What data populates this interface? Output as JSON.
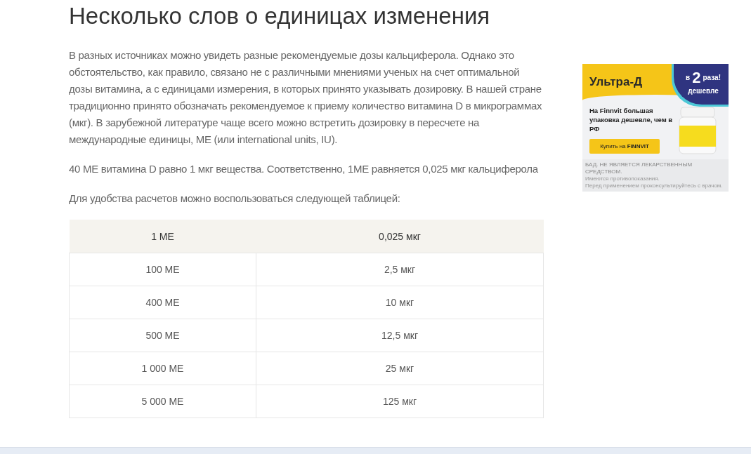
{
  "heading": "Несколько слов о единицах изменения",
  "paragraphs": [
    "В разных источниках можно увидеть разные рекомендуемые дозы кальциферола. Однако это обстоятельство, как правило, связано не с различными мнениями ученых на счет оптимальной дозы витамина, а с единицами измерения, в которых принято указывать дозировку. В нашей стране традиционно принято обозначать рекомендуемое к приему количество витамина D в микрограммах (мкг). В зарубежной литературе чаще всего можно встретить дозировку в пересчете на международные единицы, МЕ (или international units, IU).",
    "40 МЕ витамина D равно 1 мкг вещества. Соответственно, 1МЕ равняется 0,025 мкг кальциферола",
    "Для удобства расчетов можно воспользоваться следующей таблицей:"
  ],
  "table": {
    "header": [
      "1 МЕ",
      "0,025 мкг"
    ],
    "rows": [
      [
        "100 МЕ",
        "2,5 мкг"
      ],
      [
        "400 МЕ",
        "10 мкг"
      ],
      [
        "500 МЕ",
        "12,5 мкг"
      ],
      [
        "1 000 МЕ",
        "25 мкг"
      ],
      [
        "5 000 МЕ",
        "125 мкг"
      ]
    ]
  },
  "ad": {
    "brand": "Ультра-Д",
    "badge_top": "в",
    "badge_number": "2",
    "badge_word": "раза!",
    "badge_bottom": "дешевле",
    "text": "На Finnvit большая упаковка дешевле, чем в РФ",
    "button": "Купить на **FINNVIT**",
    "disclaimer": "БАД. НЕ ЯВЛЯЕТСЯ ЛЕКАРСТВЕННЫМ СРЕДСТВОМ.",
    "note_1": "Имеются противопоказания.",
    "note_2": "Перед применением проконсультируйтесь с врачом."
  }
}
